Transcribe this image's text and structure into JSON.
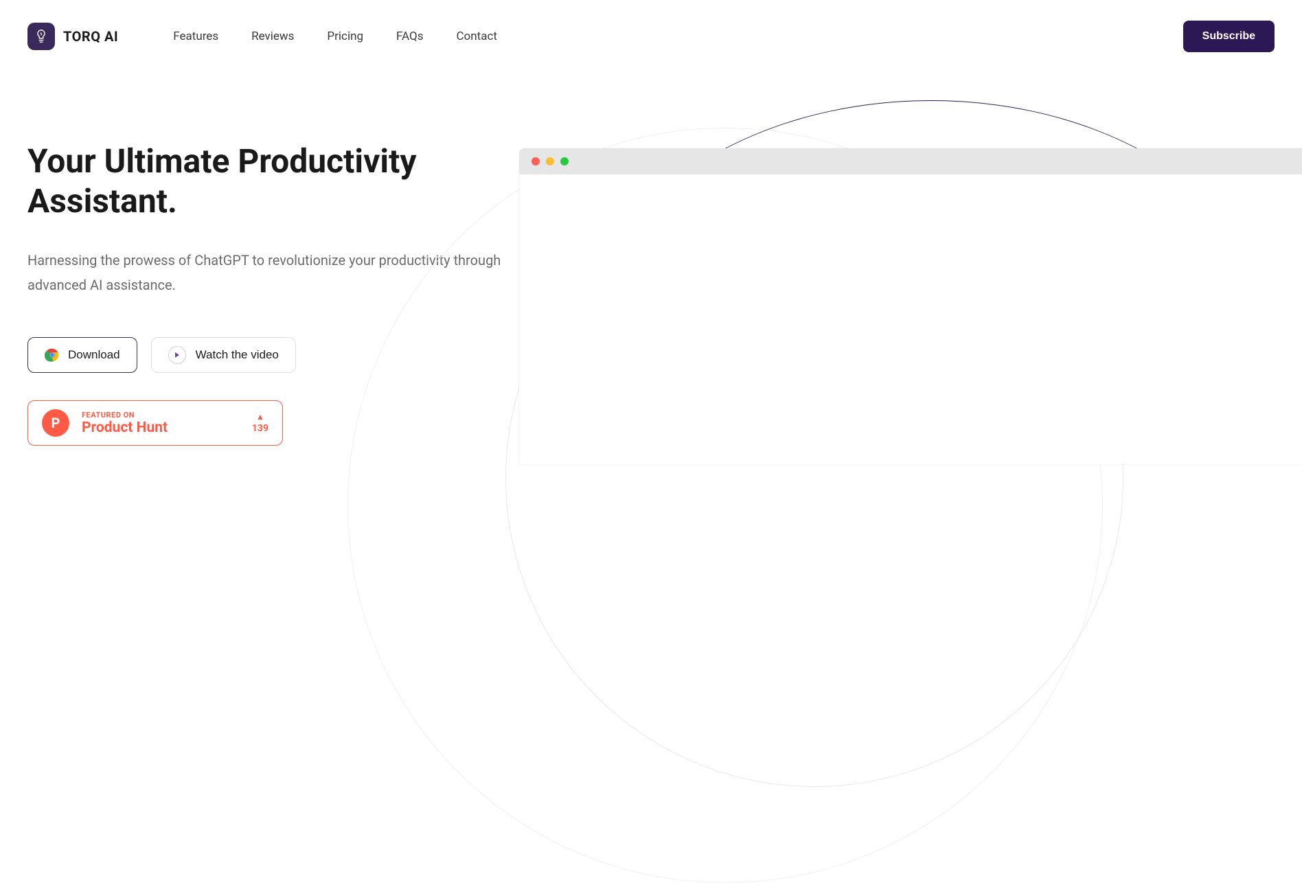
{
  "brand": {
    "name": "TORQ AI"
  },
  "nav": {
    "items": [
      {
        "label": "Features"
      },
      {
        "label": "Reviews"
      },
      {
        "label": "Pricing"
      },
      {
        "label": "FAQs"
      },
      {
        "label": "Contact"
      }
    ]
  },
  "header": {
    "subscribe_label": "Subscribe"
  },
  "hero": {
    "title": "Your Ultimate Productivity Assistant.",
    "subtitle": "Harnessing the prowess of ChatGPT to revolutionize your productivity through advanced AI assistance.",
    "download_label": "Download",
    "watch_label": "Watch the video"
  },
  "producthunt": {
    "featured_label": "FEATURED ON",
    "name": "Product Hunt",
    "votes": "139"
  }
}
